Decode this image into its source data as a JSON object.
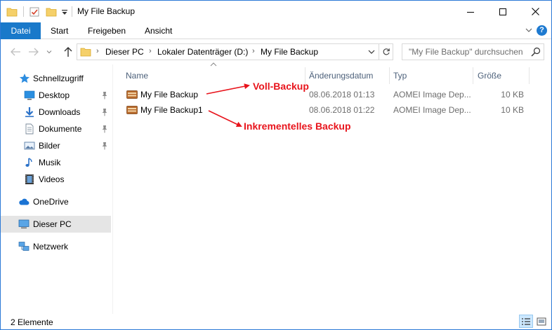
{
  "window": {
    "title": "My File Backup",
    "accent": "#1979ca"
  },
  "ribbon": {
    "tabs": [
      {
        "label": "Datei"
      },
      {
        "label": "Start"
      },
      {
        "label": "Freigeben"
      },
      {
        "label": "Ansicht"
      }
    ],
    "help": "?"
  },
  "address": {
    "crumbs": [
      "Dieser PC",
      "Lokaler Datenträger (D:)",
      "My File Backup"
    ],
    "search_placeholder": "\"My File Backup\" durchsuchen"
  },
  "sidebar": {
    "items": [
      {
        "label": "Schnellzugriff",
        "icon": "star-icon"
      },
      {
        "label": "Desktop",
        "icon": "desktop-icon",
        "pinned": true
      },
      {
        "label": "Downloads",
        "icon": "download-icon",
        "pinned": true
      },
      {
        "label": "Dokumente",
        "icon": "document-icon",
        "pinned": true
      },
      {
        "label": "Bilder",
        "icon": "pictures-icon",
        "pinned": true
      },
      {
        "label": "Musik",
        "icon": "music-icon"
      },
      {
        "label": "Videos",
        "icon": "video-icon"
      },
      {
        "label": "OneDrive",
        "icon": "cloud-icon"
      },
      {
        "label": "Dieser PC",
        "icon": "computer-icon",
        "selected": true
      },
      {
        "label": "Netzwerk",
        "icon": "network-icon"
      }
    ]
  },
  "columns": {
    "name": "Name",
    "date": "Änderungsdatum",
    "type": "Typ",
    "size": "Größe"
  },
  "files": [
    {
      "name": "My File Backup",
      "date": "08.06.2018 01:13",
      "type": "AOMEI Image Dep...",
      "size": "10 KB"
    },
    {
      "name": "My File Backup1",
      "date": "08.06.2018 01:22",
      "type": "AOMEI Image Dep...",
      "size": "10 KB"
    }
  ],
  "annotations": {
    "full": "Voll-Backup",
    "incremental": "Inkrementelles Backup",
    "color": "#e8141c"
  },
  "status": {
    "count": "2 Elemente"
  }
}
